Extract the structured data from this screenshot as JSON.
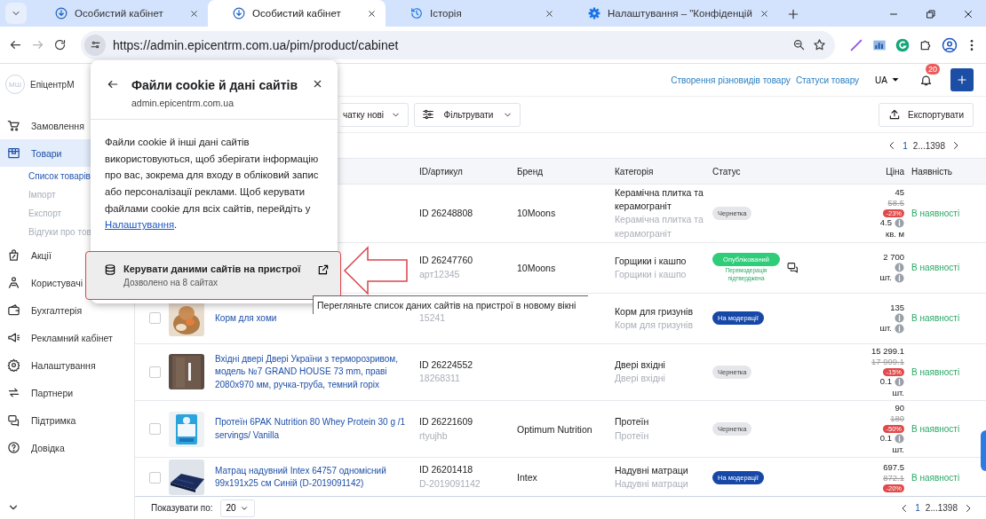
{
  "browser": {
    "tabs": [
      {
        "title": "Особистий кабінет",
        "kind": "site",
        "selected": false
      },
      {
        "title": "Особистий кабінет",
        "kind": "site",
        "selected": true
      },
      {
        "title": "Історія",
        "kind": "history",
        "selected": false
      },
      {
        "title": "Налаштування – \"Конфіденцій",
        "kind": "settings",
        "selected": false
      }
    ],
    "url": "https://admin.epicentrm.com.ua/pim/product/cabinet"
  },
  "sidebar": {
    "account": {
      "initials": "МШ",
      "name": "ЕпіцентрМ"
    },
    "items": [
      {
        "label": "Замовлення",
        "selected": false
      },
      {
        "label": "Товари",
        "selected": true,
        "children": [
          {
            "label": "Список товарів",
            "selected": true
          },
          {
            "label": "Імпорт",
            "selected": false
          },
          {
            "label": "Експорт",
            "selected": false
          },
          {
            "label": "Відгуки про тов",
            "selected": false
          }
        ]
      },
      {
        "label": "Акції",
        "selected": false
      },
      {
        "label": "Користувачі",
        "selected": false
      },
      {
        "label": "Бухгалтерія",
        "selected": false
      },
      {
        "label": "Рекламний кабінет",
        "selected": false
      },
      {
        "label": "Налаштування",
        "selected": false
      },
      {
        "label": "Партнери",
        "selected": false
      },
      {
        "label": "Підтримка",
        "selected": false
      },
      {
        "label": "Довідка",
        "selected": false
      }
    ]
  },
  "header": {
    "links": [
      "Створення різновидів товару",
      "Статуси товару"
    ],
    "language": "UA",
    "notifications": "20"
  },
  "toolbar": {
    "sort": "чатку нові",
    "filter": "Фільтрувати",
    "export": "Експортувати"
  },
  "pagination": {
    "pages": [
      {
        "label": "1",
        "selected": true
      },
      {
        "label": "2...1398",
        "selected": false
      }
    ]
  },
  "table": {
    "columns": [
      "ID/артикул",
      "Бренд",
      "Категорія",
      "Статус",
      "Ціна",
      "Наявність"
    ],
    "rows": [
      {
        "id": "ID 26248808",
        "brand": "10Moons",
        "category": "Керамічна плитка та керамограніт",
        "subcategory": "Керамічна плитка та керамограніт",
        "status": {
          "label": "Чернетка",
          "kind": "draft"
        },
        "price": {
          "value": "45",
          "old": "58.5",
          "discount": "-23%",
          "qty": "4.5",
          "unit": "кв. м"
        },
        "availability": "В наявності"
      },
      {
        "id": "ID 26247760",
        "article": "арт12345",
        "brand": "10Moons",
        "category": "Горщики і кашпо",
        "subcategory": "Горщики і кашпо",
        "status": {
          "label": "Опублікований",
          "kind": "published",
          "note": "Перемодерація підтверджена"
        },
        "price": {
          "value": "2 700",
          "unit": "шт."
        },
        "availability": "В наявності"
      },
      {
        "name": "Корм для хоми",
        "checked": false,
        "article": "15241",
        "category": "Корм для гризунів",
        "subcategory": "Корм для гризунів",
        "status": {
          "label": "На модерації",
          "kind": "moderation"
        },
        "price": {
          "value": "135",
          "unit": "шт."
        },
        "availability": "В наявності"
      },
      {
        "checked": false,
        "name": "Вхідні двері Двері України з терморозривом, модель №7 GRAND HOUSE 73 mm, праві 2080х970 мм, ручка-труба, темний горіх",
        "id": "ID 26224552",
        "article": "18268311",
        "category": "Двері вхідні",
        "subcategory": "Двері вхідні",
        "status": {
          "label": "Чернетка",
          "kind": "draft"
        },
        "price": {
          "value": "15 299.1",
          "old": "17 999.1",
          "discount": "-15%",
          "qty": "0.1",
          "unit": "шт."
        },
        "availability": "В наявності"
      },
      {
        "checked": false,
        "name": "Протеїн 6PAK Nutrition 80 Whey Protein 30 g /1 servings/ Vanilla",
        "id": "ID 26221609",
        "article": "rtyujhb",
        "brand": "Optimum Nutrition",
        "category": "Протеїн",
        "subcategory": "Протеїн",
        "status": {
          "label": "Чернетка",
          "kind": "draft"
        },
        "price": {
          "value": "90",
          "old": "180",
          "discount": "-50%",
          "qty": "0.1",
          "unit": "шт."
        },
        "availability": "В наявності"
      },
      {
        "checked": false,
        "name": "Матрац надувний Intex 64757 одномісний 99x191x25 см Синій (D-2019091142)",
        "id": "ID 26201418",
        "article": "D-2019091142",
        "brand": "Intex",
        "category": "Надувні матраци",
        "subcategory": "Надувні матраци",
        "status": {
          "label": "На модерації",
          "kind": "moderation"
        },
        "price": {
          "value": "697.5",
          "old": "872.1",
          "discount": "-20%"
        },
        "availability": "В наявності"
      }
    ]
  },
  "footer": {
    "page_size_label": "Показувати по:",
    "page_size": "20",
    "pages": [
      {
        "label": "1",
        "selected": true
      },
      {
        "label": "2...1398",
        "selected": false
      }
    ]
  },
  "cookie_popup": {
    "title": "Файли cookie й дані сайтів",
    "site": "admin.epicentrm.com.ua",
    "description": "Файли cookie й інші дані сайтів використовуються, щоб зберігати інформацію про вас, зокрема для входу в обліковий запис або персоналізації реклами. Щоб керувати файлами cookie для всіх сайтів, перейдіть у",
    "link": "Налаштування",
    "link_after": ".",
    "manage": {
      "title": "Керувати даними сайтів на пристрої",
      "subtitle": "Дозволено на 8 сайтах"
    }
  },
  "tooltip": "Перегляньте список даних сайтів на пристрої в новому вікні"
}
